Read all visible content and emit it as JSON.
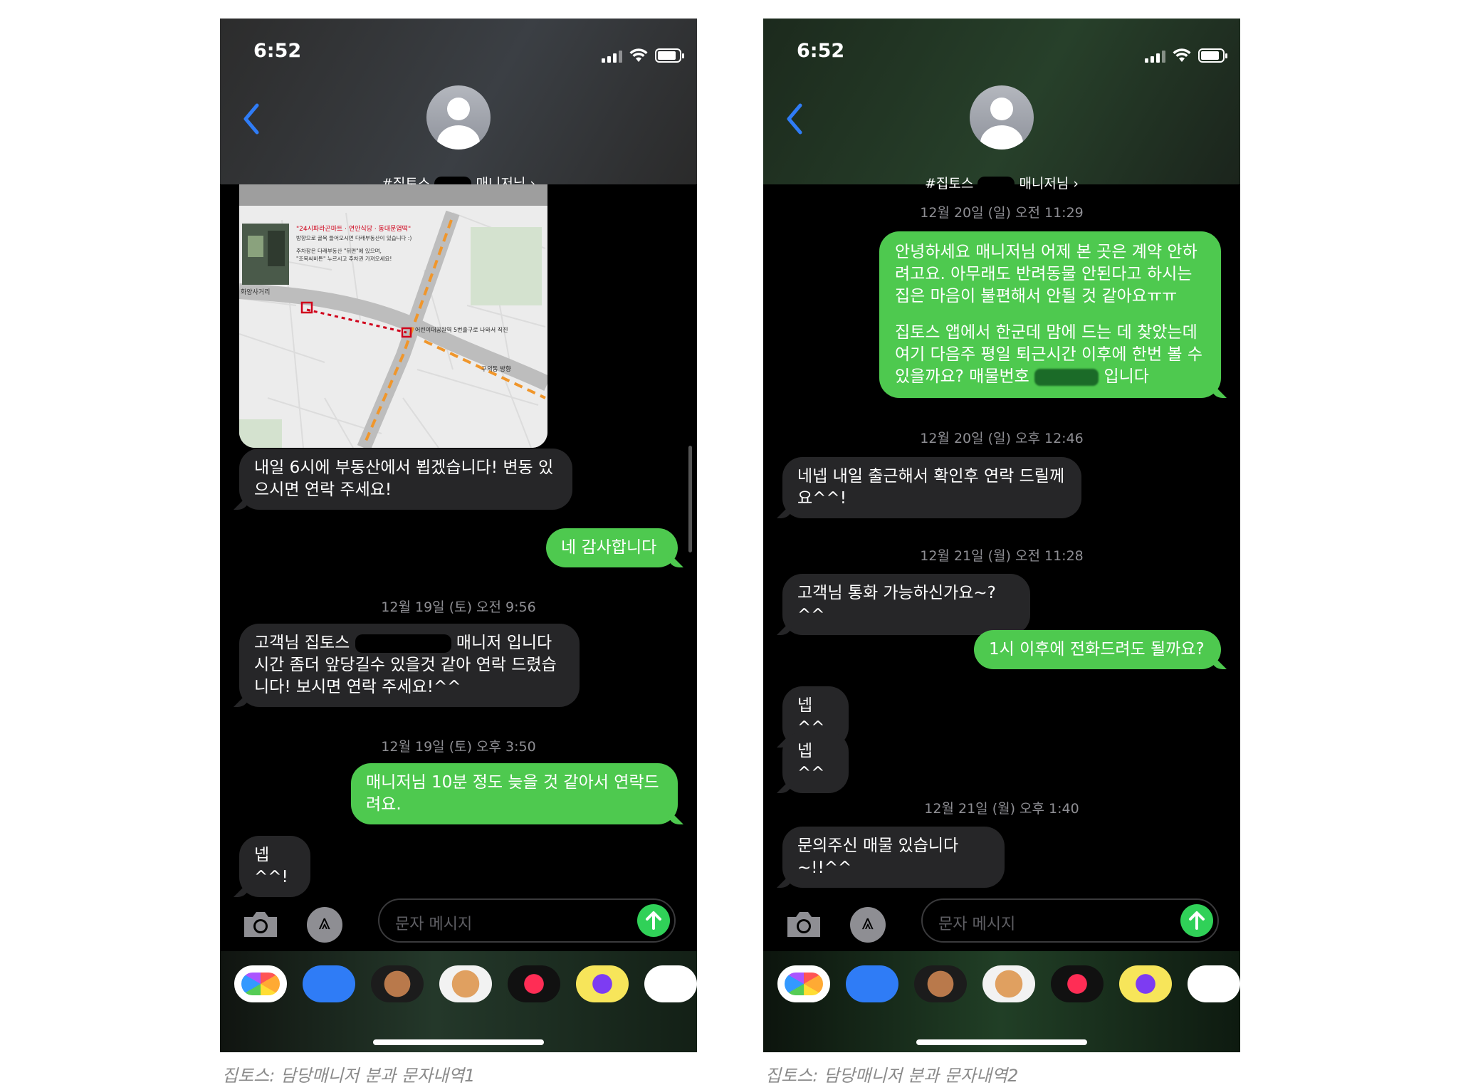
{
  "screens": [
    {
      "status": {
        "time": "6:52"
      },
      "contact": {
        "name_prefix": "#집토스",
        "name_suffix": "매니저님 ›"
      },
      "map": {
        "label_store": "\"24시파라곤마트 · 연안식당 · 동대문엽떡\"",
        "label_line2": "방향으로 골목 들어오시면 다래부동산이 있습니다 :)",
        "label_parking1": "주차장은 다래부동산 \"뒤편\"에 있으며,",
        "label_parking2": "\"조목씨비튼\" 누르시고 주차권 가져오세요!",
        "label_intersection": "화양사거리",
        "label_station_exit": "어린이대공원역 5번출구로 나와서 직진",
        "label_direction": "구의동 방향"
      },
      "messages": {
        "m1": "내일 6시에 부동산에서 뵙겠습니다! 변동 있으시면 연락 주세요!",
        "m2": "네 감사합니다",
        "ts1": "12월 19일 (토) 오전 9:56",
        "m3a": "고객님 집토스",
        "m3b": "매니저 입니다",
        "m3c": "시간 좀더 앞당길수 있을것 같아 연락 드렸습니다! 보시면 연락 주세요!^^",
        "ts2": "12월 19일 (토) 오후 3:50",
        "m4": "매니저님 10분 정도 늦을 것 같아서 연락드려요.",
        "m5": "넵^^!"
      },
      "input": {
        "placeholder": "문자 메시지"
      },
      "caption": "집토스: 담당매니저 분과 문자내역1"
    },
    {
      "status": {
        "time": "6:52"
      },
      "contact": {
        "name_prefix": "#집토스",
        "name_suffix": "매니저님 ›"
      },
      "messages": {
        "ts1": "12월 20일 (일) 오전 11:29",
        "m1a": "안녕하세요 매니저님 어제 본 곳은 계약 안하려고요. 아무래도 반려동물 안된다고 하시는 집은 마음이 불편해서 안될 것 같아요ㅠㅠ",
        "m1b": "집토스 앱에서 한군데 맘에 드는 데 찾았는데 여기 다음주 평일 퇴근시간 이후에 한번 볼 수 있을까요? 매물번호",
        "m1c": "입니다",
        "ts2": "12월 20일 (일) 오후 12:46",
        "m2": "네넵 내일 출근해서 확인후 연락 드릴께요^^!",
        "ts3": "12월 21일 (월) 오전 11:28",
        "m3": "고객님 통화 가능하신가요~?^^",
        "m4": "1시 이후에 전화드려도 될까요?",
        "m5": "넵^^",
        "m6": "넵^^",
        "ts4": "12월 21일 (월) 오후 1:40",
        "m7": "문의주신 매물 있습니다~!!^^"
      },
      "input": {
        "placeholder": "문자 메시지"
      },
      "caption": "집토스: 담당매니저 분과 문자내역2"
    }
  ],
  "colors": {
    "incoming": "#262628",
    "outgoing": "#4ec94f",
    "timestamp": "#8e8e93"
  },
  "icons": [
    "back-chevron-icon",
    "camera-icon",
    "app-store-icon",
    "send-arrow-icon",
    "photos-icon",
    "memoji-icon",
    "digital-touch-icon",
    "music-icon",
    "shopping-bag-icon"
  ]
}
